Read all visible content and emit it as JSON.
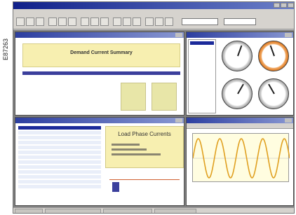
{
  "figure_code": "E87263",
  "panels": {
    "demand": {
      "title": "Demand Current Summary"
    },
    "phase": {
      "title": "Load Phase Currents"
    }
  },
  "icons": [
    "minimize-icon",
    "maximize-icon",
    "close-icon",
    "toolbar-icon"
  ],
  "colors": {
    "titlebar": "#10208a",
    "banner": "#f7efb0",
    "selection": "#1b2a9a",
    "wave": "#e0a020"
  }
}
